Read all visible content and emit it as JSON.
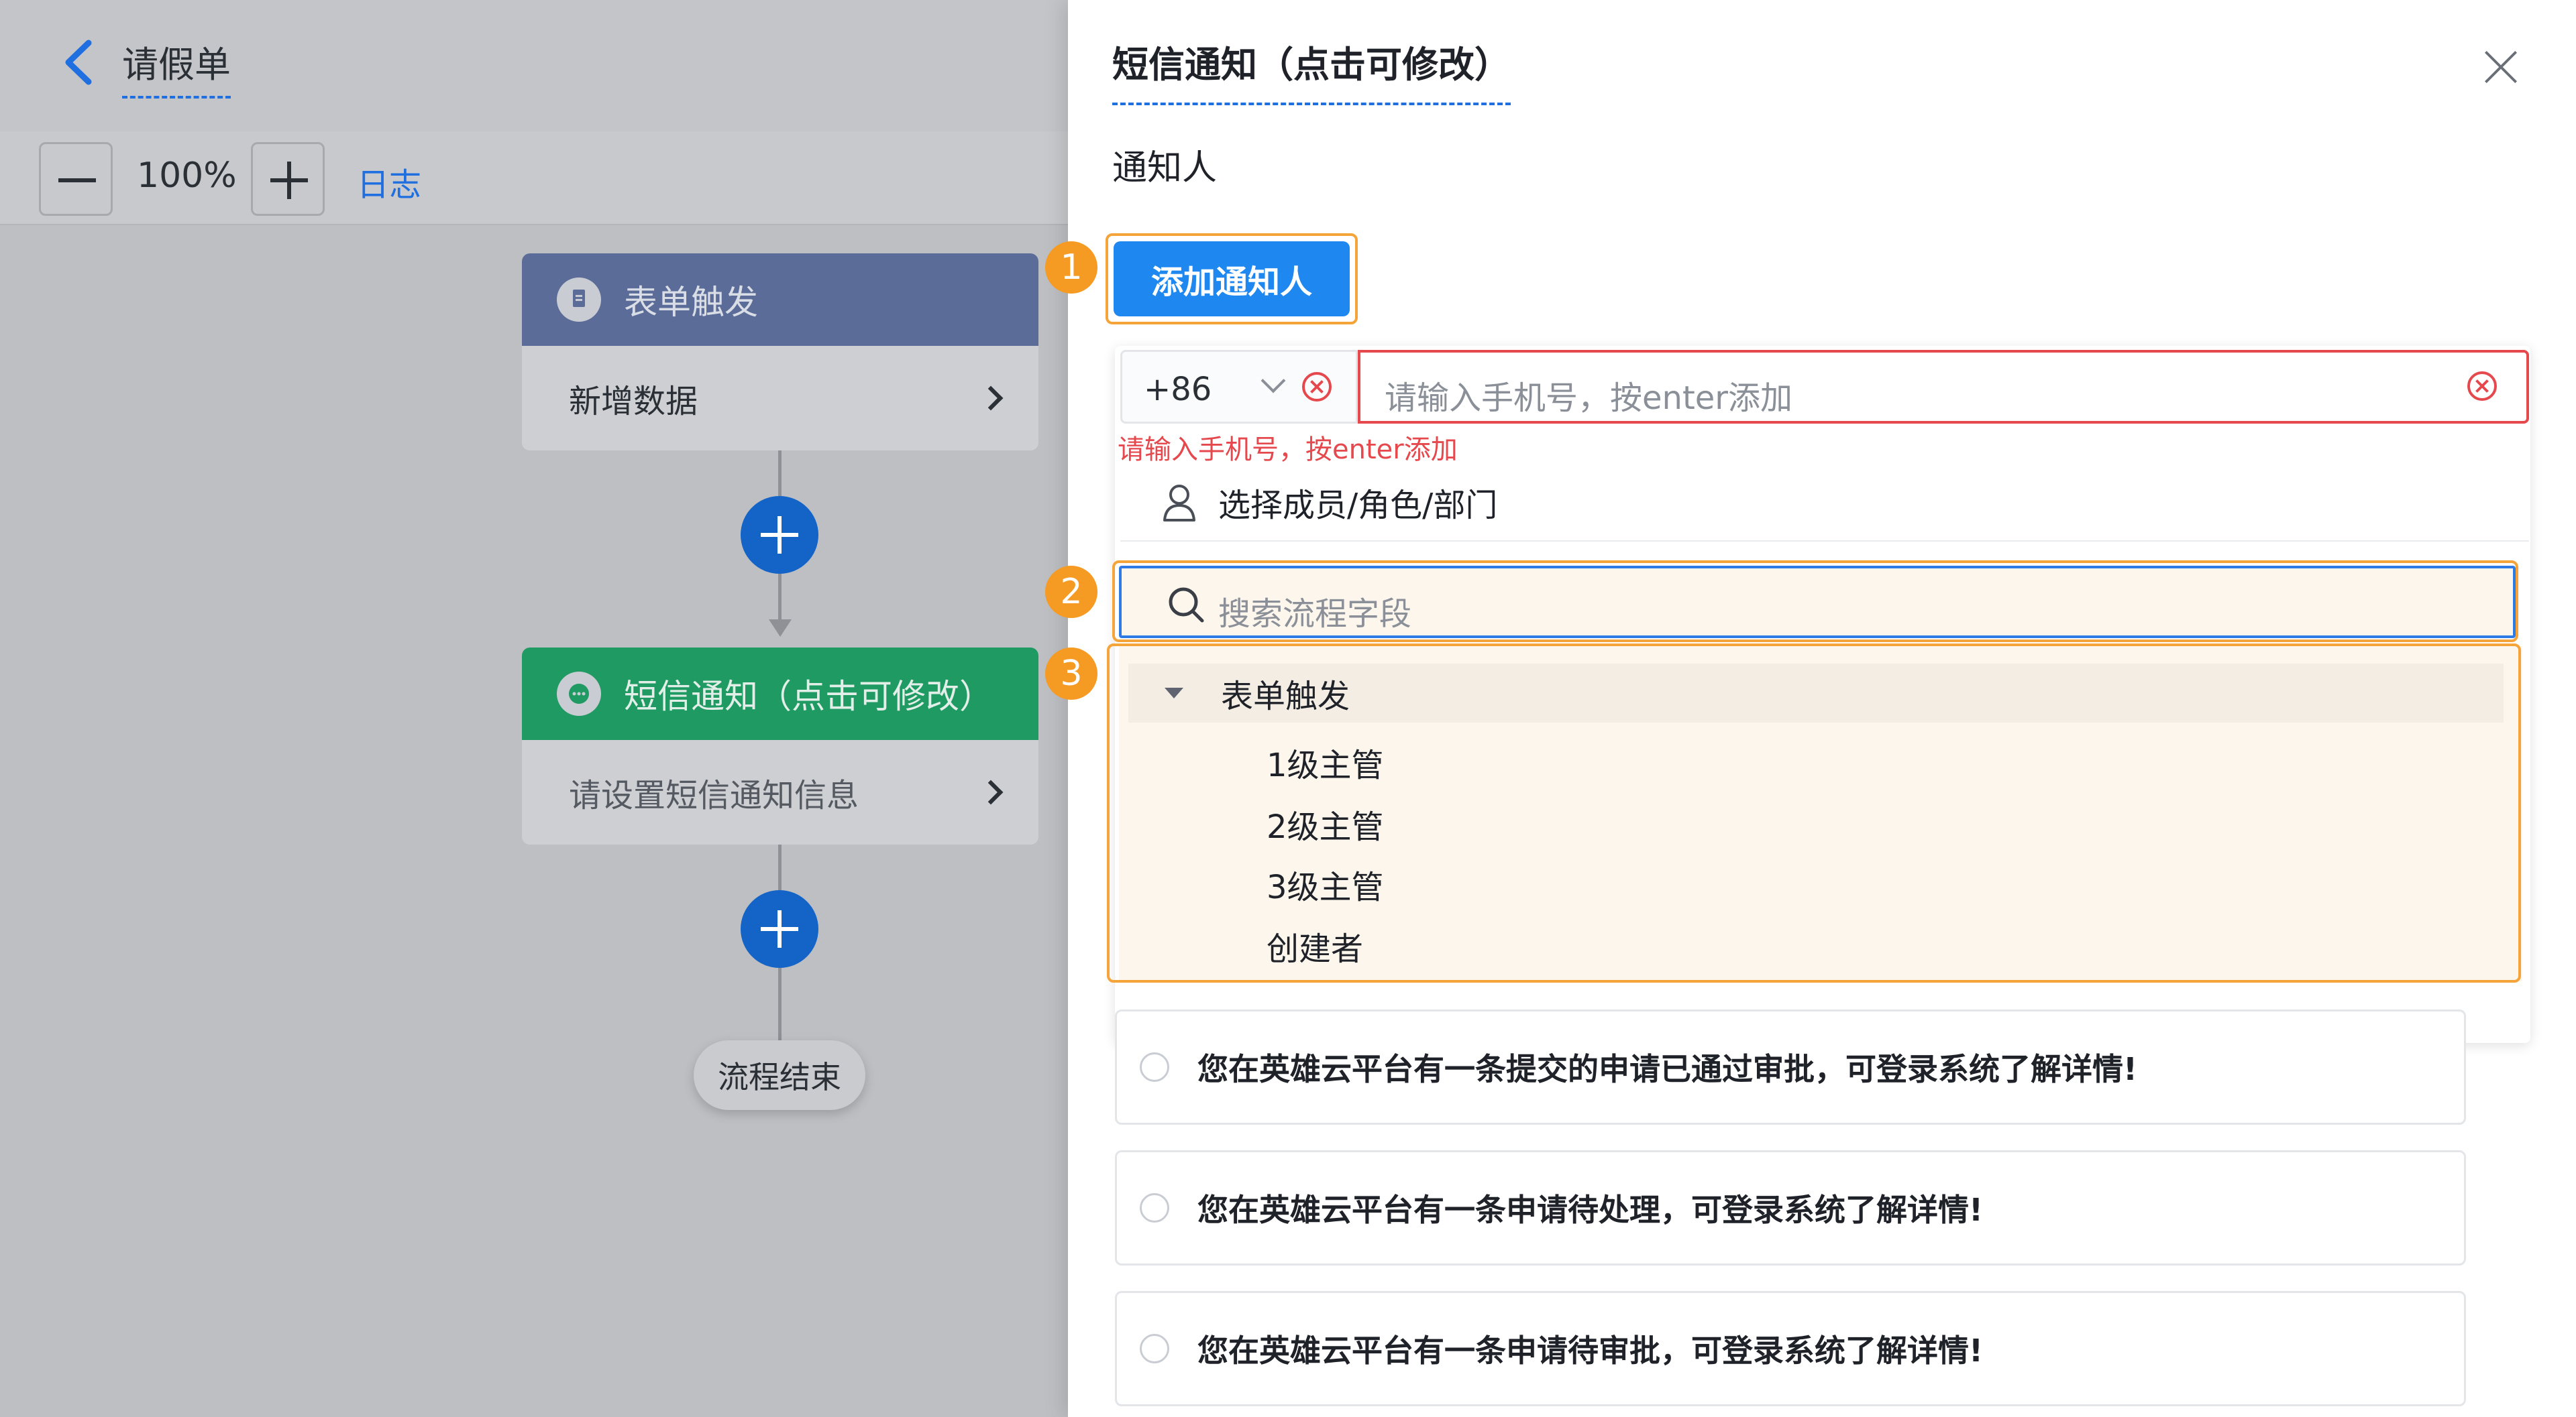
{
  "header": {
    "title": "请假单"
  },
  "zoom": {
    "value": "100%",
    "log_link": "日志"
  },
  "flow": {
    "node1": {
      "title": "表单触发",
      "body": "新增数据"
    },
    "node2": {
      "title": "短信通知（点击可修改）",
      "body": "请设置短信通知信息"
    },
    "end_label": "流程结束"
  },
  "drawer": {
    "title": "短信通知（点击可修改）",
    "section_label": "通知人",
    "add_button_label": "添加通知人",
    "country_code": "+86",
    "phone_placeholder": "请输入手机号，按enter添加",
    "phone_error": "请输入手机号，按enter添加",
    "member_select_label": "选择成员/角色/部门",
    "search_placeholder": "搜索流程字段",
    "tree": {
      "parent": "表单触发",
      "children": [
        "1级主管",
        "2级主管",
        "3级主管",
        "创建者"
      ]
    },
    "templates": [
      "您在英雄云平台有一条提交的申请已通过审批，可登录系统了解详情!",
      "您在英雄云平台有一条申请待处理，可登录系统了解详情!",
      "您在英雄云平台有一条申请待审批，可登录系统了解详情!"
    ]
  },
  "callouts": [
    "1",
    "2",
    "3"
  ],
  "colors": {
    "primary": "#1e87f0",
    "accent_blue": "#1f6fe0",
    "error": "#e5484d",
    "callout": "#f59a23",
    "trigger_node": "#5c6c98",
    "sms_node": "#1f9a62"
  }
}
